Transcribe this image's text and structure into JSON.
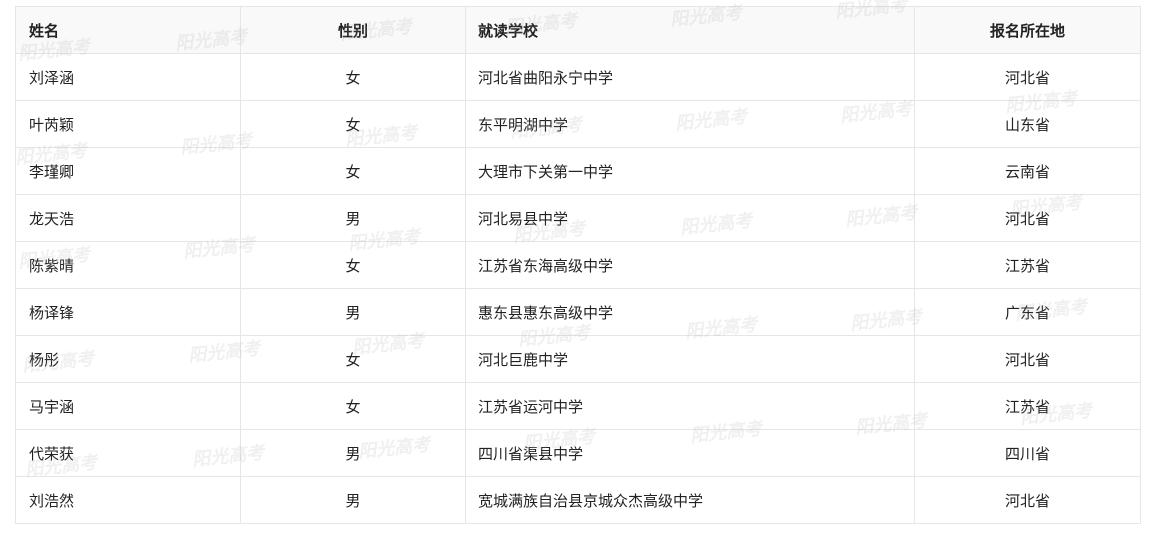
{
  "table": {
    "headers": [
      "姓名",
      "性别",
      "就读学校",
      "报名所在地"
    ],
    "rows": [
      [
        "刘泽涵",
        "女",
        "河北省曲阳永宁中学",
        "河北省"
      ],
      [
        "叶芮颖",
        "女",
        "东平明湖中学",
        "山东省"
      ],
      [
        "李瑾卿",
        "女",
        "大理市下关第一中学",
        "云南省"
      ],
      [
        "龙天浩",
        "男",
        "河北易县中学",
        "河北省"
      ],
      [
        "陈紫晴",
        "女",
        "江苏省东海高级中学",
        "江苏省"
      ],
      [
        "杨译锋",
        "男",
        "惠东县惠东高级中学",
        "广东省"
      ],
      [
        "杨彤",
        "女",
        "河北巨鹿中学",
        "河北省"
      ],
      [
        "马宇涵",
        "女",
        "江苏省运河中学",
        "江苏省"
      ],
      [
        "代荣获",
        "男",
        "四川省渠县中学",
        "四川省"
      ],
      [
        "刘浩然",
        "男",
        "宽城满族自治县京城众杰高级中学",
        "河北省"
      ]
    ]
  },
  "watermark": {
    "text": "阳光高考"
  }
}
